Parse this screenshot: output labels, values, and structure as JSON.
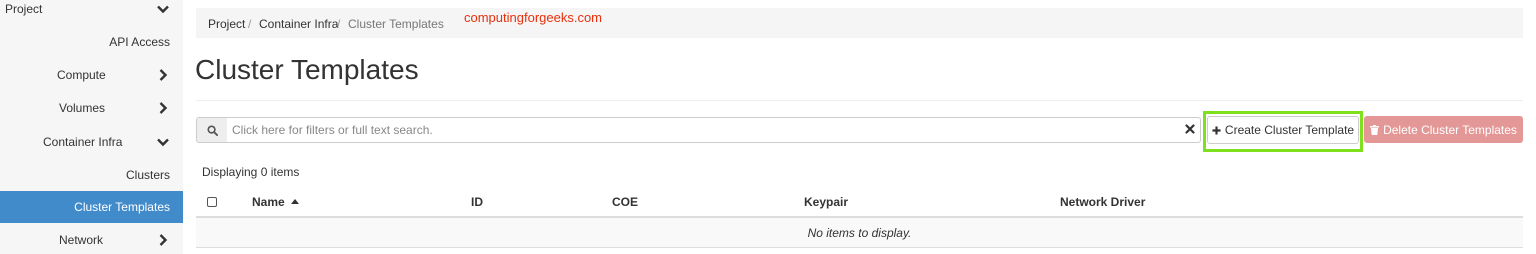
{
  "sidebar": {
    "items": [
      {
        "label": "Project",
        "chevron": "down"
      },
      {
        "label": "API Access"
      },
      {
        "label": "Compute",
        "chevron": "right"
      },
      {
        "label": "Volumes",
        "chevron": "right"
      },
      {
        "label": "Container Infra",
        "chevron": "down"
      },
      {
        "label": "Clusters"
      },
      {
        "label": "Cluster Templates",
        "active": true
      },
      {
        "label": "Network",
        "chevron": "right"
      }
    ]
  },
  "breadcrumb": {
    "items": [
      "Project",
      "Container Infra",
      "Cluster Templates"
    ],
    "separator": "/"
  },
  "watermark": "computingforgeeks.com",
  "page_title": "Cluster Templates",
  "search": {
    "placeholder": "Click here for filters or full text search.",
    "value": ""
  },
  "actions": {
    "create_label": "Create Cluster Template",
    "delete_label": "Delete Cluster Templates"
  },
  "table": {
    "count_text": "Displaying 0 items",
    "columns": [
      "Name",
      "ID",
      "COE",
      "Keypair",
      "Network Driver"
    ],
    "empty_message": "No items to display."
  },
  "colors": {
    "accent": "#428bca",
    "highlight": "#7fe01e",
    "danger_disabled": "#e39796",
    "watermark": "#e8300e"
  },
  "icons": {
    "search": "search-icon",
    "clear": "close-icon",
    "create": "plus-icon",
    "delete": "trash-icon",
    "sort": "sort-up-icon"
  }
}
